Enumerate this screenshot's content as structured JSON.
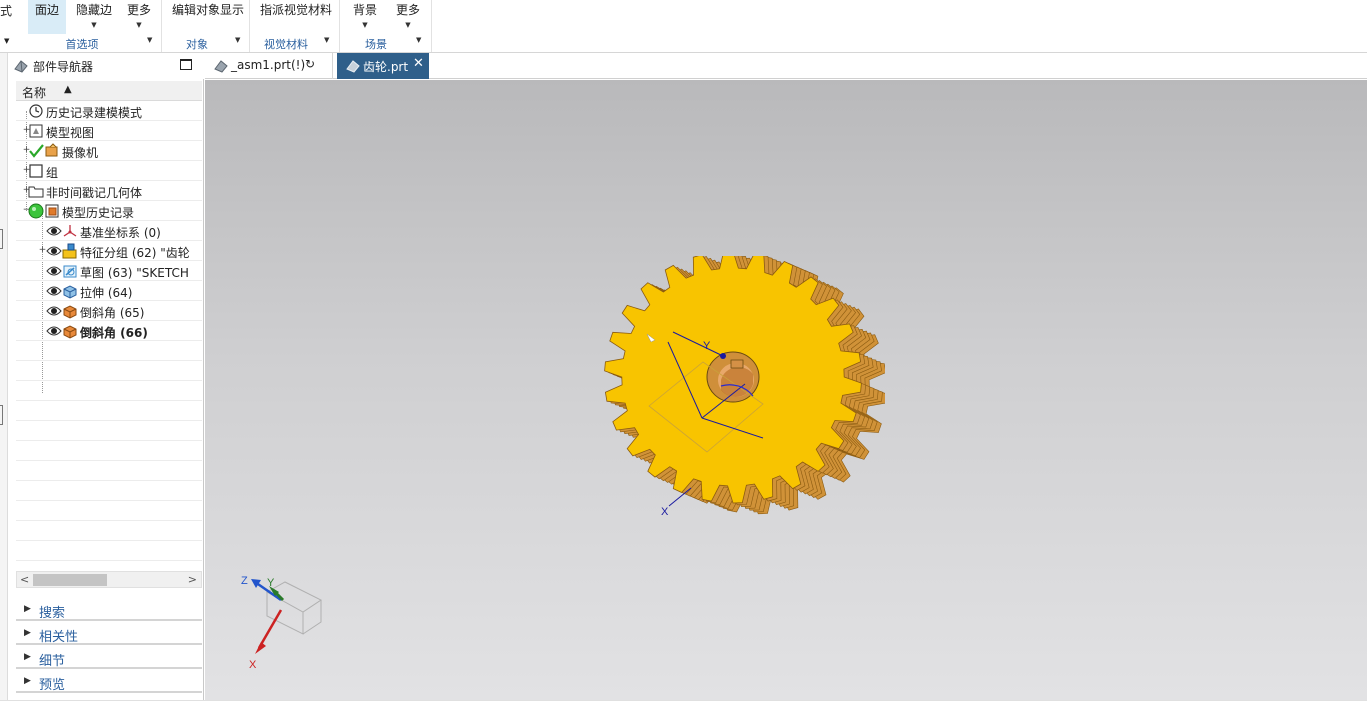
{
  "ribbon": {
    "partial_label": "式",
    "buttons": [
      {
        "label": "面边",
        "active": true
      },
      {
        "label": "隐藏边"
      },
      {
        "label": "更多"
      },
      {
        "label": "编辑对象显示"
      },
      {
        "label": "指派视觉材料"
      },
      {
        "label": "背景"
      },
      {
        "label": "更多"
      }
    ],
    "groups": [
      {
        "title": "首选项"
      },
      {
        "title": "对象"
      },
      {
        "title": "视觉材料"
      },
      {
        "title": "场景"
      }
    ]
  },
  "navigator": {
    "title": "部件导航器",
    "column_header": "名称",
    "sort_icon": "sort-ascending-icon",
    "tree": [
      {
        "label": "历史记录建模模式",
        "icon": "clock-icon",
        "expander": ""
      },
      {
        "label": "模型视图",
        "icon": "model-view-icon",
        "expander": "+"
      },
      {
        "label": "摄像机",
        "icon": "camera-icon",
        "expander": "+",
        "check": true
      },
      {
        "label": "组",
        "icon": "group-icon",
        "expander": "+"
      },
      {
        "label": "非时间戳记几何体",
        "icon": "folder-icon",
        "expander": "+"
      },
      {
        "label": "模型历史记录",
        "icon": "model-history-icon",
        "expander": "−",
        "status": "green"
      },
      {
        "label": "基准坐标系 (0)",
        "icon": "datum-csys-icon",
        "expander": "",
        "child": true
      },
      {
        "label": "特征分组 (62) \"齿轮",
        "icon": "feature-group-icon",
        "expander": "+",
        "child": true
      },
      {
        "label": "草图 (63) \"SKETCH",
        "icon": "sketch-icon",
        "expander": "",
        "child": true
      },
      {
        "label": "拉伸 (64)",
        "icon": "extrude-icon",
        "expander": "",
        "child": true
      },
      {
        "label": "倒斜角 (65)",
        "icon": "chamfer-icon",
        "expander": "",
        "child": true
      },
      {
        "label": "倒斜角 (66)",
        "icon": "chamfer-icon",
        "expander": "",
        "child": true,
        "bold": true
      }
    ],
    "sections": [
      {
        "label": "搜索"
      },
      {
        "label": "相关性"
      },
      {
        "label": "细节"
      },
      {
        "label": "预览"
      }
    ]
  },
  "tabs": [
    {
      "label": "_asm1.prt(!)",
      "status_icon": "refresh-icon"
    },
    {
      "label": "齿轮.prt",
      "close": "✕",
      "active": true
    }
  ],
  "viewport": {
    "gear_colors": {
      "face": "#f8c400",
      "side": "#d09238",
      "edge": "#8a5a10"
    },
    "csys_labels": {
      "y": "Y",
      "x": "X"
    },
    "triad_labels": {
      "z": "Z",
      "y": "Y",
      "x": "X"
    }
  }
}
